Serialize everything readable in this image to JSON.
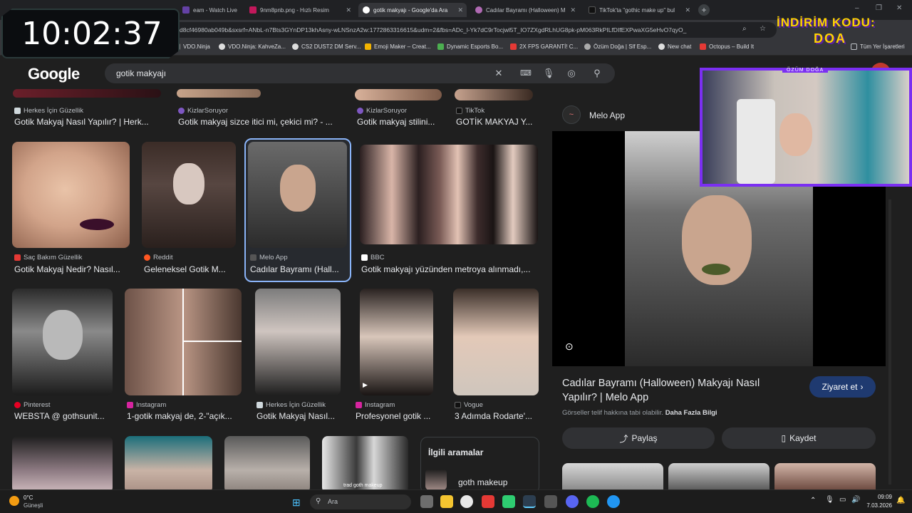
{
  "tabs": [
    {
      "label": "eam - Watch Live",
      "color": "#6441a5"
    },
    {
      "label": "9nm8pnb.png - Hızlı Resim",
      "color": "#c2185b"
    },
    {
      "label": "gotik makyajı - Google'da Ara",
      "color": "#ffffff",
      "active": true
    },
    {
      "label": "Cadılar Bayramı (Halloween) M",
      "color": "#b06ab3"
    },
    {
      "label": "TikTok'ta \"gothic make up\" bul",
      "color": "#111111"
    }
  ],
  "address": {
    "url": "d8cf46980ab049b&sxsrf=ANbL-n7Bts3GYnDP13khAsny-wLNSnzA2w:1772863316615&udm=2&fbs=ADc_l-Yk7dC9rTocjwl5T_IO7ZXgdRLhUG8pk-pM063RkPILfDIfEXPwaXG5eHvO7qyO_"
  },
  "bookmarks": [
    {
      "label": "VDO.Ninja",
      "color": "#888888"
    },
    {
      "label": "VDO.Ninja: KahveZa...",
      "color": "#dddddd"
    },
    {
      "label": "CS2 DUST2 DM Serv...",
      "color": "#dddddd"
    },
    {
      "label": "Emoji Maker – Creat...",
      "color": "#f4b400"
    },
    {
      "label": "Dynamic Esports Bo...",
      "color": "#4caf50"
    },
    {
      "label": "2X FPS GARANTİ! C...",
      "color": "#e53935"
    },
    {
      "label": "Özüm Doğa | Slf Esp...",
      "color": "#aaaaaa"
    },
    {
      "label": "New chat",
      "color": "#dddddd"
    },
    {
      "label": "Octopus – Build It",
      "color": "#e53935"
    },
    {
      "label": "Tüm Yer İşaretleri",
      "color": "#bdc1c6"
    }
  ],
  "google": {
    "logo": "Google",
    "query": "gotik makyajı"
  },
  "results": {
    "row0": [
      {
        "source": "Herkes İçin Güzellik",
        "title": "Gotik Makyaj Nasıl Yapılır? | Herk..."
      },
      {
        "source": "KizlarSoruyor",
        "title": "Gotik makyaj sizce itici mi, çekici mi? - ..."
      },
      {
        "source": "KizlarSoruyor",
        "title": "Gotik makyaj stilini..."
      },
      {
        "source": "TikTok",
        "title": "GOTİK MAKYAJ Y..."
      }
    ],
    "row1": [
      {
        "source": "Saç Bakım Güzellik",
        "title": "Gotik Makyaj Nedir? Nasıl..."
      },
      {
        "source": "Reddit",
        "title": "Geleneksel Gotik M..."
      },
      {
        "source": "Melo App",
        "title": "Cadılar Bayramı (Hall..."
      },
      {
        "source": "BBC",
        "title": "Gotik makyajı yüzünden metroya alınmadı,..."
      }
    ],
    "row2": [
      {
        "source": "Pinterest",
        "title": "WEBSTA @ gothsunit..."
      },
      {
        "source": "Instagram",
        "title": "1-gotik makyaj de, 2-\"açık..."
      },
      {
        "source": "Herkes İçin Güzellik",
        "title": "Gotik Makyaj Nasıl..."
      },
      {
        "source": "Instagram",
        "title": "Profesyonel gotik ..."
      },
      {
        "source": "Vogue",
        "title": "3 Adımda Rodarte'..."
      }
    ],
    "row3_caption": "trad goth makeup",
    "related": {
      "heading": "İlgili aramalar",
      "item": "goth makeup"
    }
  },
  "panel": {
    "site": "Melo App",
    "title": "Cadılar Bayramı (Halloween) Makyajı Nasıl Yapılır? | Melo App",
    "visit": "Ziyaret et",
    "copyright": "Görseller telif hakkına tabi olabilir.",
    "more_info": "Daha Fazla Bilgi",
    "share": "Paylaş",
    "save": "Kaydet"
  },
  "overlay": {
    "clock": "10:02:37",
    "promo_line1": "İNDİRİM KODU:",
    "promo_line2": "DOA",
    "cam_name": "ÖZÜM DOĞA"
  },
  "taskbar": {
    "weather_temp": "0°C",
    "weather_desc": "Güneşli",
    "search": "Ara",
    "time": "09:09",
    "date": "7.03.2026"
  },
  "colors": {
    "accent": "#8ab4f8",
    "panel_btn": "#303134",
    "visit_btn": "#1f3a70",
    "cam_border": "#7b2ff2"
  }
}
